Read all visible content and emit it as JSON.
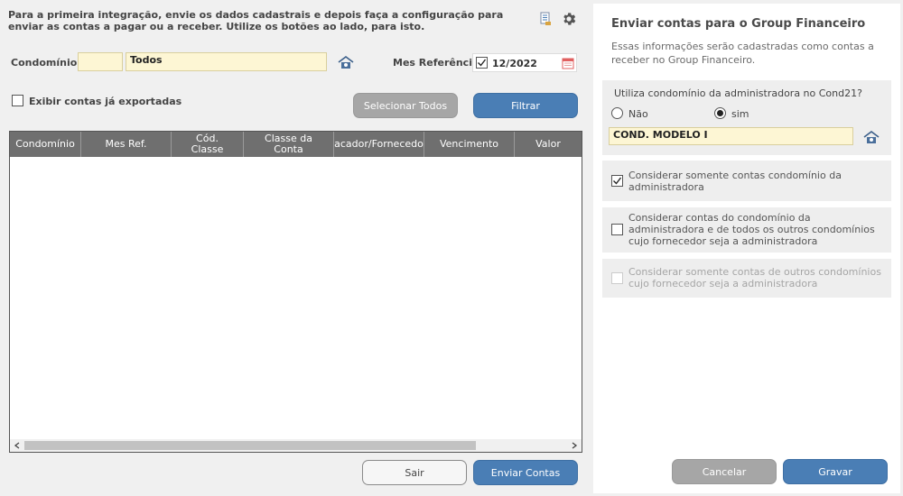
{
  "intro": {
    "text": "Para a primeira integração, envie os dados cadastrais e depois faça a configuração para enviar as contas a pagar ou a receber. Utilize os botões ao lado, para isto."
  },
  "filters": {
    "condominio_label": "Condomínio:",
    "condominio_code": "",
    "condominio_name": "Todos",
    "mes_label": "Mes Referência:",
    "mes_value": "12/2022",
    "exibir_label": "Exibir contas já exportadas",
    "selecionar_label": "Selecionar Todos",
    "filtrar_label": "Filtrar"
  },
  "grid": {
    "columns": [
      "Condomínio",
      "Mes Ref.",
      "Cód.\nClasse",
      "Classe da\nConta",
      "acador/Fornecedo",
      "Vencimento",
      "Valor"
    ]
  },
  "footer": {
    "sair_label": "Sair",
    "enviar_label": "Enviar Contas"
  },
  "side": {
    "title": "Enviar contas para o Group Financeiro",
    "subtitle": "Essas informações serão cadastradas como contas a receber no Group Financeiro.",
    "question": "Utiliza condomínio da administradora no Cond21?",
    "opt_nao": "Não",
    "opt_sim": "sim",
    "condominio_value": "COND. MODELO I",
    "option1": "Considerar somente contas condomínio da administradora",
    "option2": "Considerar contas do condomínio da administradora e de todos os outros condomínios cujo fornecedor seja a administradora",
    "option3": "Considerar somente contas de outros condomínios cujo fornecedor seja a administradora",
    "cancelar_label": "Cancelar",
    "gravar_label": "Gravar"
  },
  "colors": {
    "accent": "#4a7eb5",
    "field_bg": "#fdf6d4",
    "grid_header": "#6f6f6f"
  }
}
